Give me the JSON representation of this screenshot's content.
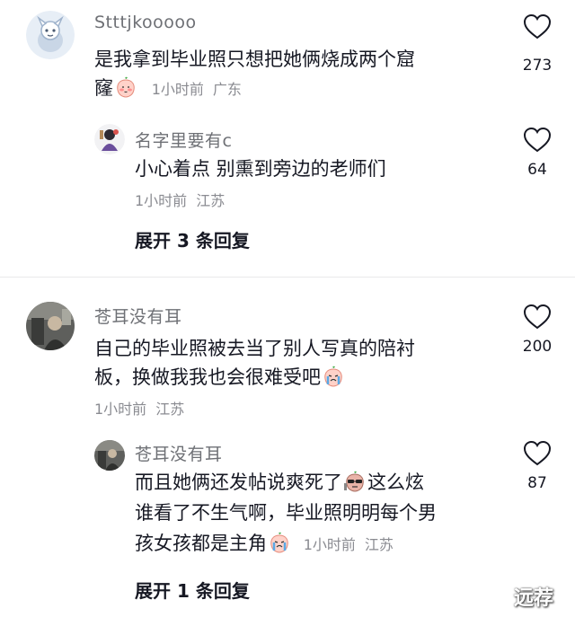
{
  "comments": [
    {
      "username": "Stttjkooooo",
      "text_line1": "是我拿到毕业照只想把她俩烧成两个窟",
      "text_line2": "窿",
      "time": "1小时前",
      "location": "广东",
      "likes": "273",
      "reply": {
        "username": "名字里要有c",
        "text_line1": "小心着点 别熏到旁边的老师们",
        "time": "1小时前",
        "location": "江苏",
        "likes": "64"
      },
      "expand_label": "展开 3 条回复"
    },
    {
      "username": "苍耳没有耳",
      "text_line1": "自己的毕业照被去当了别人写真的陪衬",
      "text_line2": "板，换做我我也会很难受吧",
      "time": "1小时前",
      "location": "江苏",
      "likes": "200",
      "reply": {
        "username": "苍耳没有耳",
        "text_line1a": "而且她俩还发帖说爽死了",
        "text_line1b": "这么炫",
        "text_line2": "谁看了不生气啊，毕业照明明每个男",
        "text_line3": "孩女孩都是主角",
        "time": "1小时前",
        "location": "江苏",
        "likes": "87"
      },
      "expand_label": "展开 1 条回复"
    }
  ],
  "watermark": "远荐",
  "icons": {
    "like": "heart-outline-icon",
    "emoji_shy": "peach-shy-emoji",
    "emoji_cry": "peach-crying-emoji",
    "emoji_sunglasses": "peach-sunglasses-emoji"
  }
}
